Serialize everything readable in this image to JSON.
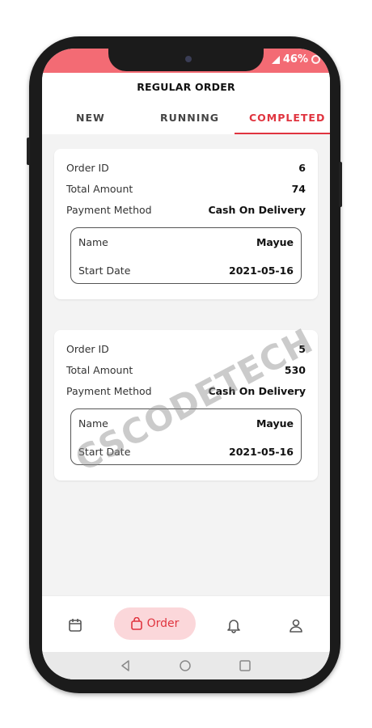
{
  "status": {
    "battery_text": "46%"
  },
  "header": {
    "title": "REGULAR ORDER"
  },
  "tabs": [
    {
      "label": "NEW"
    },
    {
      "label": "RUNNING"
    },
    {
      "label": "COMPLETED"
    }
  ],
  "orders": [
    {
      "order_id_label": "Order ID",
      "order_id": "6",
      "total_label": "Total Amount",
      "total": "74",
      "payment_label": "Payment Method",
      "payment": "Cash On Delivery",
      "name_label": "Name",
      "name": "Mayue",
      "start_label": "Start Date",
      "start": "2021-05-16"
    },
    {
      "order_id_label": "Order ID",
      "order_id": "5",
      "total_label": "Total Amount",
      "total": "530",
      "payment_label": "Payment Method",
      "payment": "Cash On Delivery",
      "name_label": "Name",
      "name": "Mayue",
      "start_label": "Start Date",
      "start": "2021-05-16"
    }
  ],
  "bottom_nav": {
    "calendar_icon": "calendar-icon",
    "order_label": "Order",
    "bell_icon": "bell-icon",
    "profile_icon": "user-icon"
  },
  "watermark": "CSCODETECH",
  "colors": {
    "accent": "#e0343f",
    "status_bar": "#f36b74",
    "pill_bg": "#fbd7da"
  }
}
